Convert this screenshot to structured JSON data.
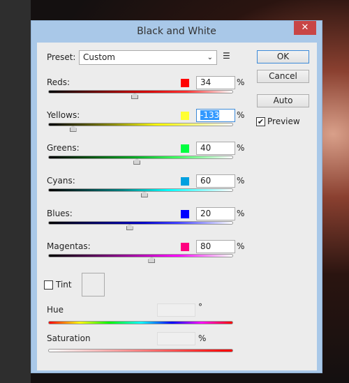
{
  "dialog": {
    "title": "Black and White",
    "close": "✕"
  },
  "preset": {
    "label": "Preset:",
    "value": "Custom",
    "menu_icon": "list-menu-icon"
  },
  "buttons": {
    "ok": "OK",
    "cancel": "Cancel",
    "auto": "Auto"
  },
  "preview": {
    "label": "Preview",
    "checked": true
  },
  "slider_range": [
    -200,
    300
  ],
  "sliders": [
    {
      "label": "Reds:",
      "value": "34",
      "color": "#ff0000",
      "gradient": "linear-gradient(90deg,#000,#c00 50%,#ff3030 75%,#fff)"
    },
    {
      "label": "Yellows:",
      "value": "-133",
      "color": "#ffff33",
      "gradient": "linear-gradient(90deg,#000,#888800 35%,#ffff00 60%,#fff)"
    },
    {
      "label": "Greens:",
      "value": "40",
      "color": "#00ff40",
      "gradient": "linear-gradient(90deg,#000,#00a020 45%,#40ff60 70%,#fff)"
    },
    {
      "label": "Cyans:",
      "value": "60",
      "color": "#00a0e0",
      "gradient": "linear-gradient(90deg,#000,#008080 40%,#00ffff 65%,#fff)"
    },
    {
      "label": "Blues:",
      "value": "20",
      "color": "#0000ff",
      "gradient": "linear-gradient(90deg,#000,#0000c0 50%,#4040ff 70%,#fff)"
    },
    {
      "label": "Magentas:",
      "value": "80",
      "color": "#ff0080",
      "gradient": "linear-gradient(90deg,#000,#a000a0 45%,#ff00ff 70%,#fff)"
    }
  ],
  "pct": "%",
  "tint": {
    "label": "Tint",
    "checked": false
  },
  "hue": {
    "label": "Hue",
    "unit": "°",
    "value": ""
  },
  "saturation": {
    "label": "Saturation",
    "unit": "%",
    "value": ""
  }
}
